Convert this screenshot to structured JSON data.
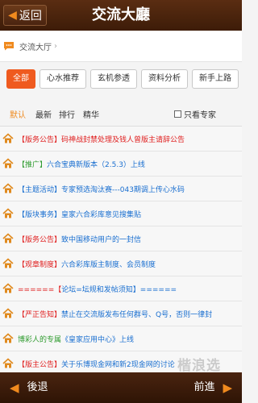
{
  "header": {
    "back_label": "返回",
    "title": "交流大廳"
  },
  "breadcrumb": {
    "label": "交流大厅",
    "separator": "›"
  },
  "categories": [
    {
      "label": "全部",
      "active": true
    },
    {
      "label": "心水推荐",
      "active": false
    },
    {
      "label": "玄机参透",
      "active": false
    },
    {
      "label": "资料分析",
      "active": false
    },
    {
      "label": "新手上路",
      "active": false
    }
  ],
  "sort_tabs": [
    {
      "label": "默认",
      "active": true
    },
    {
      "label": "最新",
      "active": false
    },
    {
      "label": "排行",
      "active": false
    },
    {
      "label": "精华",
      "active": false
    }
  ],
  "experts_only_label": "只看专家",
  "posts": [
    {
      "prefix": "【版务公告】",
      "text": "码神战封禁处理及钱人曾版主请辞公告",
      "prefix_color": "#e02020",
      "text_color": "#e02020"
    },
    {
      "prefix": "【推广】",
      "text": "六合宝典新版本（2.5.3）上线",
      "prefix_color": "#2e9b2e",
      "text_color": "#1a6fd0"
    },
    {
      "prefix": "【主题活动】",
      "text": "专家预选淘汰赛---043期调上传心水码",
      "prefix_color": "#1a6fd0",
      "text_color": "#1a6fd0"
    },
    {
      "prefix": "【版块事务】",
      "text": "皇家六合彩库意见搜集贴",
      "prefix_color": "#1a6fd0",
      "text_color": "#1a6fd0"
    },
    {
      "prefix": "【版务公告】",
      "text": "致中国移动用户的一封信",
      "prefix_color": "#e02020",
      "text_color": "#1a6fd0"
    },
    {
      "prefix": "【观章制度】",
      "text": "六合彩库版主制度、会员制度",
      "prefix_color": "#e02020",
      "text_color": "#1a6fd0"
    },
    {
      "prefix": "======【",
      "text": "论坛=坛规和发帖须知】======",
      "prefix_color": "#e02020",
      "text_color": "#1a6fd0"
    },
    {
      "prefix": "【严正告知】",
      "text": "禁止在交流版发布任何群号、Q号，否则一律封",
      "prefix_color": "#e02020",
      "text_color": "#1a6fd0"
    },
    {
      "prefix": "博彩人的专属",
      "text": "《皇家应用中心》上线",
      "prefix_color": "#2e9b2e",
      "text_color": "#1a6fd0"
    },
    {
      "prefix": "【版主公告】",
      "text": "关于乐博现金网和新2现金网的讨论",
      "prefix_color": "#e02020",
      "text_color": "#1a6fd0"
    }
  ],
  "footer": {
    "back_label": "後退",
    "forward_label": "前進"
  },
  "watermark": "楷浪选",
  "colors": {
    "header_brown": "#4a2410",
    "accent_orange": "#ef5a1f",
    "icon_orange": "#f08a1e"
  }
}
